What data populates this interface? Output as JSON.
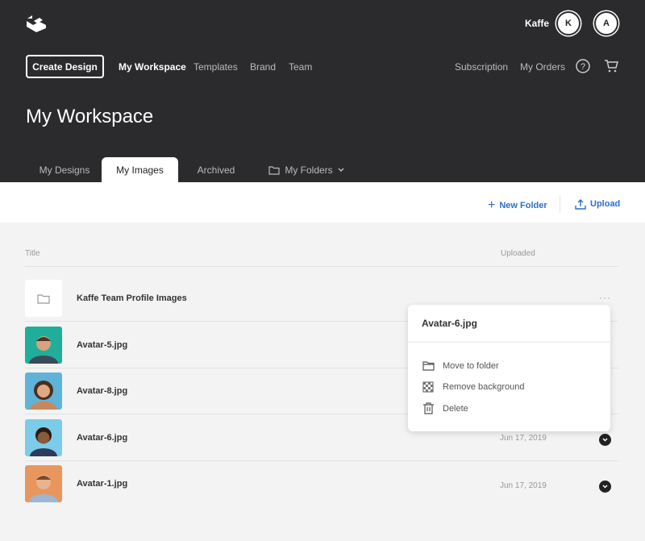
{
  "header": {
    "user": "Kaffe",
    "avatars": [
      "K",
      "A"
    ],
    "create_label": "Create Design",
    "nav": [
      "My Workspace",
      "Templates",
      "Brand",
      "Team"
    ],
    "right_nav": [
      "Subscription",
      "My Orders"
    ],
    "title": "My Workspace",
    "tabs": [
      "My Designs",
      "My Images",
      "Archived",
      "My Folders"
    ]
  },
  "toolbar": {
    "new_folder": "New Folder",
    "upload": "Upload"
  },
  "table": {
    "col_title": "Title",
    "col_uploaded": "Uploaded",
    "rows": [
      {
        "name": "Kaffe Team Profile Images",
        "date": ""
      },
      {
        "name": "Avatar-5.jpg",
        "date": ""
      },
      {
        "name": "Avatar-8.jpg",
        "date": ""
      },
      {
        "name": "Avatar-6.jpg",
        "date": "Jun 17, 2019"
      },
      {
        "name": "Avatar-1.jpg",
        "date": "Jun 17, 2019"
      }
    ]
  },
  "menu": {
    "title": "Avatar-6.jpg",
    "items": [
      "Move to folder",
      "Remove background",
      "Delete"
    ]
  },
  "colors": {
    "header": "#2b2b2d",
    "accent": "#2a6fc9"
  }
}
